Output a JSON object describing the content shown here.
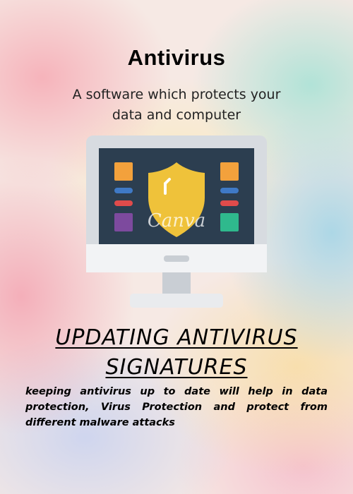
{
  "poster": {
    "title": "Antivirus",
    "subtitle": "A software which protects your data and  computer",
    "watermark": "Canva",
    "heading": "UPDATING ANTIVIRUS SIGNATURES",
    "body": "keeping antivirus up to date will help in data protection, Virus Protection and protect from different malware attacks"
  },
  "colors": {
    "screen": "#2c3e50",
    "bezel": "#d7dbe0",
    "stand": "#c9ced4",
    "shield": "#efc23a",
    "tile_orange": "#f3a13c",
    "tile_purple": "#7d4a9e",
    "tile_green": "#2fb98d",
    "bar_blue": "#3f79c6",
    "bar_red": "#e04b4b"
  },
  "icons": [
    "monitor-icon",
    "shield-icon"
  ]
}
